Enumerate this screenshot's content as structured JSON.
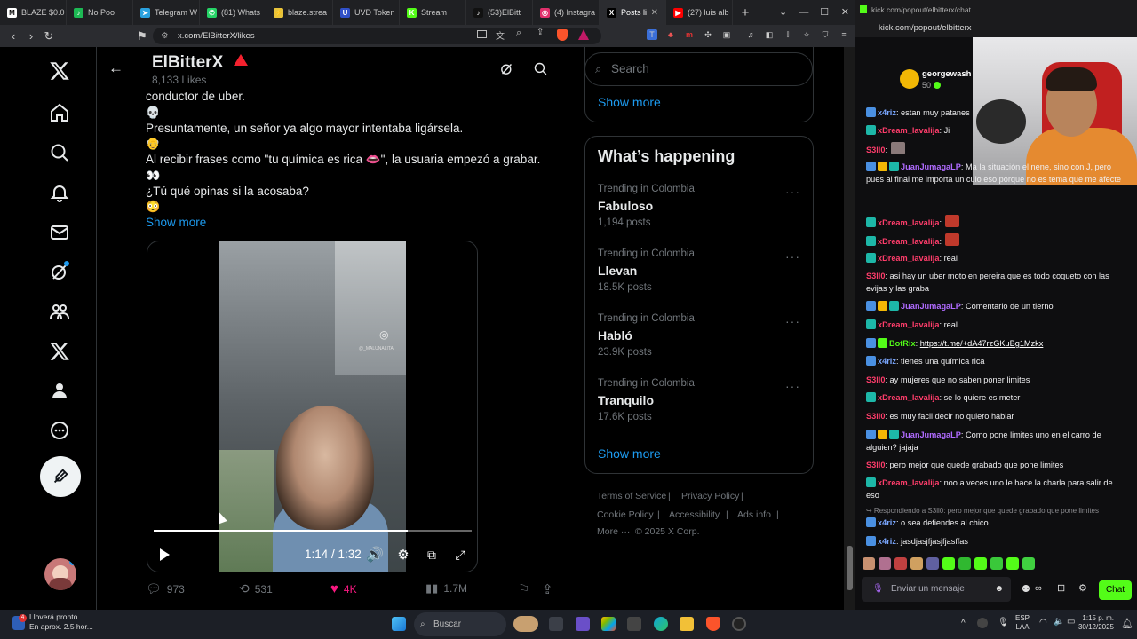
{
  "browser": {
    "tabs": [
      {
        "label": "BLAZE $0.0",
        "icon_color": "#ffffff",
        "icon_text": "M"
      },
      {
        "label": "No Poo",
        "icon_color": "#1db954",
        "icon_text": "♪"
      },
      {
        "label": "Telegram W",
        "icon_color": "#2aa2e0",
        "icon_text": "➤"
      },
      {
        "label": "(81) Whats",
        "icon_color": "#25d366",
        "icon_text": "✆"
      },
      {
        "label": "blaze.strea",
        "icon_color": "#e8c33b",
        "icon_text": "⚡"
      },
      {
        "label": "UVD Token",
        "icon_color": "#3050c8",
        "icon_text": "U"
      },
      {
        "label": "Stream",
        "icon_color": "#53fc18",
        "icon_text": "K"
      },
      {
        "label": "(53)ElBitt",
        "icon_color": "#111111",
        "icon_text": "♪"
      },
      {
        "label": "(4) Instagra",
        "icon_color": "#e1306c",
        "icon_text": "◎"
      },
      {
        "label": "Posts li",
        "icon_color": "#000000",
        "icon_text": "X"
      },
      {
        "label": "(27) luis alb",
        "icon_color": "#ff0000",
        "icon_text": "▶"
      }
    ],
    "url": "x.com/ElBitterX/likes"
  },
  "profile": {
    "name": "ElBitterX",
    "likes_count": "8,133 Likes"
  },
  "post": {
    "lines": [
      "conductor de uber.",
      "Presuntamente, un señor ya algo mayor intentaba ligársela.",
      "Al recibir frases como \"tu química es rica 👄\", la usuaria empezó a grabar.",
      "¿Tú qué opinas si la acosaba?"
    ],
    "emojis": [
      "💀",
      "👴",
      "👀",
      "😳"
    ],
    "show_more": "Show more",
    "video": {
      "time": "1:14 / 1:32",
      "progress": 0.8,
      "watermark": "@_MALUNALITA"
    },
    "actions": {
      "replies": "973",
      "reposts": "531",
      "likes": "4K",
      "views": "1.7M"
    }
  },
  "sidebar_right": {
    "search_placeholder": "Search",
    "show_more_top": "Show more",
    "whats_happening_title": "What’s happening",
    "trends": [
      {
        "meta": "Trending in Colombia",
        "name": "Fabuloso",
        "posts": "1,194 posts"
      },
      {
        "meta": "Trending in Colombia",
        "name": "Llevan",
        "posts": "18.5K posts"
      },
      {
        "meta": "Trending in Colombia",
        "name": "Habló",
        "posts": "23.9K posts"
      },
      {
        "meta": "Trending in Colombia",
        "name": "Tranquilo",
        "posts": "17.6K posts"
      }
    ],
    "show_more_bottom": "Show more",
    "footer": {
      "terms": "Terms of Service",
      "privacy": "Privacy Policy",
      "cookie": "Cookie Policy",
      "accessibility": "Accessibility",
      "ads": "Ads info",
      "more": "More ···",
      "copyright": "© 2025 X Corp."
    }
  },
  "chat": {
    "window_title": "kick.com/popout/elbitterx/chat",
    "url": "kick.com/popout/elbitterx",
    "pinned_user": "georgewash",
    "pinned_amount": "50",
    "messages": [
      {
        "user": "x4riz",
        "color": "#7aa7ff",
        "text": ": estan muy patanes",
        "icons": [
          "#4a90e2"
        ]
      },
      {
        "user": "xDream_lavalija",
        "color": "#ff3d6b",
        "text": ": Ji",
        "icons": [
          "#1db7a8"
        ]
      },
      {
        "user": "S3ll0",
        "color": "#ff3d6b",
        "text": ":",
        "icons": []
      },
      {
        "user": "JuanJumagaLP",
        "color": "#b06bff",
        "text": ": Ma la situación el nene, sino con J, pero pues al final me importa un culo eso porque no es tema que me afecte",
        "icons": [
          "#4a90e2",
          "#f2b705",
          "#1db7a8"
        ]
      },
      {
        "user": "xDream_lavalija",
        "color": "#ff3d6b",
        "text": ":",
        "icons": [
          "#1db7a8"
        ]
      },
      {
        "user": "xDream_lavalija",
        "color": "#ff3d6b",
        "text": ":",
        "icons": [
          "#1db7a8"
        ]
      },
      {
        "user": "xDream_lavalija",
        "color": "#ff3d6b",
        "text": ": real",
        "icons": [
          "#1db7a8"
        ]
      },
      {
        "user": "S3ll0",
        "color": "#ff3d6b",
        "text": ": asi hay un uber moto en pereira que es todo coqueto con las evijas y las graba",
        "icons": []
      },
      {
        "user": "JuanJumagaLP",
        "color": "#b06bff",
        "text": ": Comentario de un tierno",
        "icons": [
          "#4a90e2",
          "#f2b705",
          "#1db7a8"
        ]
      },
      {
        "user": "xDream_lavalija",
        "color": "#ff3d6b",
        "text": ": real",
        "icons": [
          "#1db7a8"
        ]
      },
      {
        "user": "BotRix",
        "color": "#53fc18",
        "text": ": ",
        "link": "https://t.me/+dA47rzGKuBg1Mzkx",
        "icons": [
          "#4a90e2",
          "#53fc18"
        ]
      },
      {
        "user": "x4riz",
        "color": "#7aa7ff",
        "text": ": tienes una química rica",
        "icons": [
          "#4a90e2"
        ]
      },
      {
        "user": "S3ll0",
        "color": "#ff3d6b",
        "text": ": ay mujeres que no saben poner limites",
        "icons": []
      },
      {
        "user": "xDream_lavalija",
        "color": "#ff3d6b",
        "text": ": se lo quiere es meter",
        "icons": [
          "#1db7a8"
        ]
      },
      {
        "user": "S3ll0",
        "color": "#ff3d6b",
        "text": ": es muy facil decir no quiero hablar",
        "icons": []
      },
      {
        "user": "JuanJumagaLP",
        "color": "#b06bff",
        "text": ": Como pone limites uno en el carro de alguien? jajaja",
        "icons": [
          "#4a90e2",
          "#f2b705",
          "#1db7a8"
        ]
      },
      {
        "user": "S3ll0",
        "color": "#ff3d6b",
        "text": ": pero mejor que quede grabado que pone limites",
        "icons": []
      },
      {
        "user": "xDream_lavalija",
        "color": "#ff3d6b",
        "text": ": noo a veces uno le hace la charla para salir de eso",
        "icons": [
          "#1db7a8"
        ]
      },
      {
        "user": "x4riz",
        "color": "#7aa7ff",
        "text": ": o sea defiendes al chico",
        "icons": [
          "#4a90e2"
        ]
      },
      {
        "user": "x4riz",
        "color": "#7aa7ff",
        "text": ": jasdjasjfjasjfjasffas",
        "icons": [
          "#4a90e2"
        ]
      }
    ],
    "reply_note": "↪ Respondiendo a S3ll0: pero mejor que quede grabado que pone limites",
    "input_placeholder": "Enviar un mensaje",
    "send_label": "Chat"
  },
  "taskbar": {
    "weather_title": "Lloverá pronto",
    "weather_sub": "En aprox. 2.5 hor...",
    "search": "Buscar",
    "lang": "ESP",
    "lang2": "LAA",
    "time": "1:15 p. m.",
    "date": "30/12/2025"
  }
}
